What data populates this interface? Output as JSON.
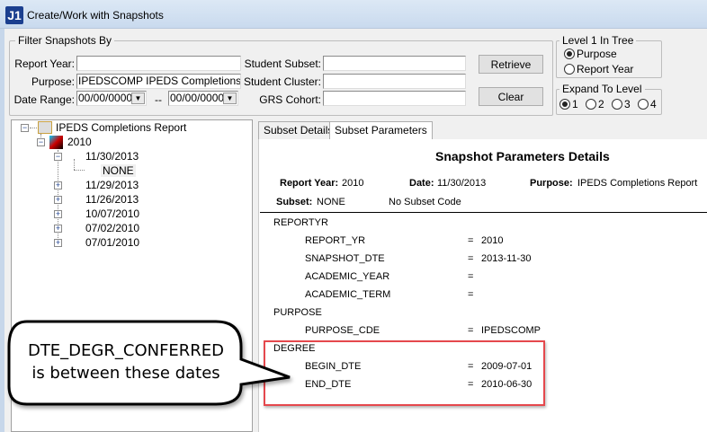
{
  "window": {
    "title": "Create/Work with Snapshots",
    "logo": "J1"
  },
  "filter": {
    "group_label": "Filter Snapshots By",
    "report_year_label": "Report Year:",
    "report_year_value": "",
    "purpose_label": "Purpose:",
    "purpose_value": "IPEDSCOMP   IPEDS Completions Rep",
    "date_range_label": "Date Range:",
    "date_from": "00/00/0000",
    "date_sep": "--",
    "date_to": "00/00/0000",
    "student_subset_label": "Student Subset:",
    "student_cluster_label": "Student Cluster:",
    "grs_cohort_label": "GRS Cohort:",
    "retrieve": "Retrieve",
    "clear": "Clear"
  },
  "level1": {
    "label": "Level 1 In Tree",
    "options": [
      "Purpose",
      "Report Year"
    ],
    "selected": "Purpose"
  },
  "expand": {
    "label": "Expand To Level",
    "options": [
      "1",
      "2",
      "3",
      "4"
    ],
    "selected": "1"
  },
  "tree": {
    "root": "IPEDS Completions Report",
    "year": "2010",
    "dates": [
      "11/30/2013",
      "11/29/2013",
      "11/26/2013",
      "10/07/2010",
      "07/02/2010",
      "07/01/2010"
    ],
    "subset": "NONE"
  },
  "tabs": [
    "Subset Details",
    "Subset Parameters"
  ],
  "details": {
    "title": "Snapshot Parameters Details",
    "report_year_label": "Report Year:",
    "report_year": "2010",
    "date_label": "Date:",
    "date": "11/30/2013",
    "purpose_label": "Purpose:",
    "purpose": "IPEDS Completions Report",
    "subset_label": "Subset:",
    "subset": "NONE",
    "subset_code": "No Subset Code",
    "sections": [
      {
        "name": "REPORTYR",
        "params": [
          {
            "key": "REPORT_YR",
            "value": "2010"
          },
          {
            "key": "SNAPSHOT_DTE",
            "value": "2013-11-30"
          },
          {
            "key": "ACADEMIC_YEAR",
            "value": ""
          },
          {
            "key": "ACADEMIC_TERM",
            "value": ""
          }
        ]
      },
      {
        "name": "PURPOSE",
        "params": [
          {
            "key": "PURPOSE_CDE",
            "value": "IPEDSCOMP"
          }
        ]
      },
      {
        "name": "DEGREE",
        "params": [
          {
            "key": "BEGIN_DTE",
            "value": "2009-07-01"
          },
          {
            "key": "END_DTE",
            "value": "2010-06-30"
          }
        ]
      }
    ]
  },
  "callout": {
    "line1": "DTE_DEGR_CONFERRED",
    "line2": "is between these dates"
  },
  "colors": {
    "highlight": "#e5484d"
  }
}
